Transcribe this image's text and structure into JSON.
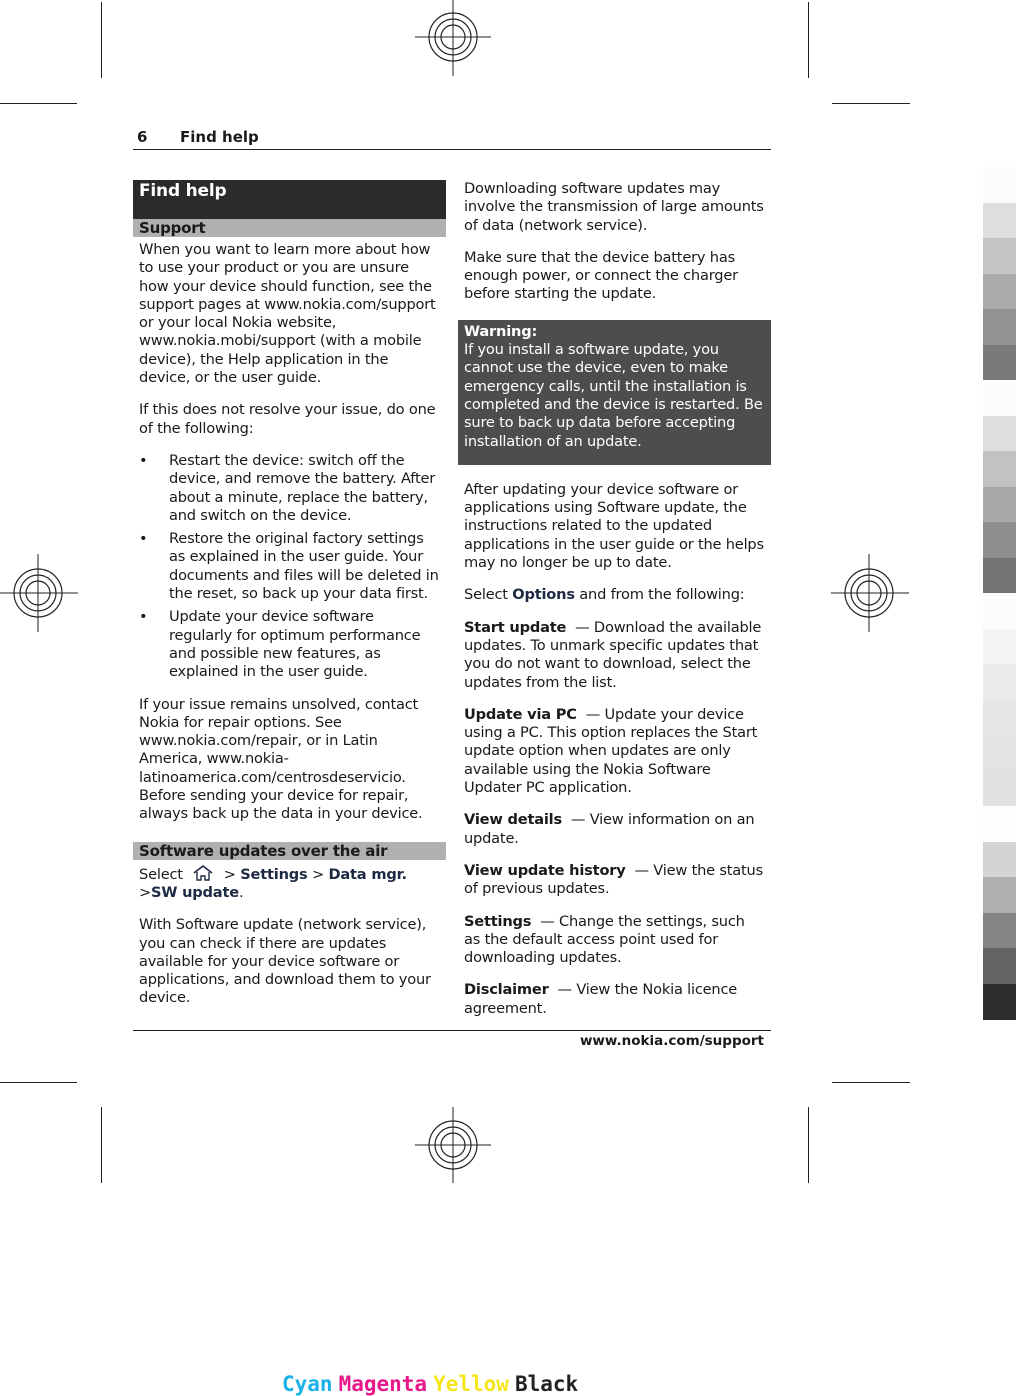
{
  "header": {
    "page_number": "6",
    "section_title": "Find help"
  },
  "left_column": {
    "title": "Find help",
    "support": {
      "heading": "Support",
      "intro": "When you want to learn more about how to use your product or you are unsure how your device should function, see the support pages at www.nokia.com/support or your local Nokia website, www.nokia.mobi/support (with a mobile device), the Help application in the device, or the user guide.",
      "if_not": "If this does not resolve your issue, do one of the following:",
      "bullets": [
        "Restart the device: switch off the device, and remove the battery. After about a minute, replace the battery, and switch on the device.",
        "Restore the original factory settings as explained in the user guide. Your documents and files will be deleted in the reset, so back up your data first.",
        "Update your device software regularly for optimum performance and possible new features, as explained in the user guide."
      ],
      "bullet_glyph": "•",
      "unsolved": "If your issue remains unsolved, contact Nokia for repair options. See www.nokia.com/repair, or in Latin America, www.nokia-latinoamerica.com/centrosdeservicio. Before sending your device for repair, always back up the data in your device."
    },
    "ota": {
      "heading": "Software updates over the air",
      "select_prefix": "Select",
      "home_icon": "home-icon",
      "path": [
        "Settings",
        "Data mgr.",
        "SW update"
      ],
      "separator": ">",
      "period": ".",
      "description": "With Software update (network service), you can check if there are updates available for your device software or applications, and download them to your device."
    }
  },
  "right_column": {
    "download_note": "Downloading software updates may involve the transmission of large amounts of data (network service).",
    "battery_note": "Make sure that the device battery has enough power, or connect the charger before starting the update.",
    "warning": {
      "label": "Warning:",
      "text": "If you install a software update, you cannot use the device, even to make emergency calls, until the installation is completed and the device is restarted. Be sure to back up data before accepting installation of an update."
    },
    "after_update": "After updating your device software or applications using Software update, the instructions related to the updated applications in the user guide or the helps may no longer be up to date.",
    "select_options": {
      "prefix": "Select",
      "options_label": "Options",
      "suffix": "and from the following:"
    },
    "options": [
      {
        "name": "Start update",
        "desc": "— Download the available updates. To unmark specific updates that you do not want to download, select the updates from the list."
      },
      {
        "name": "Update via PC",
        "desc": "— Update your device using a PC. This option replaces the Start update option when updates are only available using the Nokia Software Updater PC application."
      },
      {
        "name": "View details",
        "desc": "— View information on an update."
      },
      {
        "name": "View update history",
        "desc": "— View the status of previous updates."
      },
      {
        "name": "Settings",
        "desc": "— Change the settings, such as the default access point used for downloading updates."
      },
      {
        "name": "Disclaimer",
        "desc": "— View the Nokia licence agreement."
      }
    ]
  },
  "footer": {
    "url": "www.nokia.com/support"
  },
  "print_marks": {
    "color_bar_top": [
      "#fcfcfc",
      "#dedede",
      "#c4c4c4",
      "#ababab",
      "#929292",
      "#7a7a7a",
      "#fcfcfc",
      "#dedede",
      "#c2c2c2",
      "#a8a8a8",
      "#8e8e8e",
      "#737373"
    ],
    "color_bar_bottom": [
      "#fcfcfc",
      "#f5f5f5",
      "#ebebeb",
      "#e6e6e6",
      "#e3e3e3",
      "#e1e1e1",
      "#fdfdfd",
      "#d4d4d4",
      "#afafaf",
      "#848484",
      "#636363",
      "#2d2d2d"
    ],
    "cmyk_labels": [
      {
        "text": "Cyan",
        "color": "#1ab0e8"
      },
      {
        "text": "Magenta",
        "color": "#e8198b"
      },
      {
        "text": "Yellow",
        "color": "#f5e61a"
      },
      {
        "text": "Black",
        "color": "#222222"
      }
    ]
  }
}
